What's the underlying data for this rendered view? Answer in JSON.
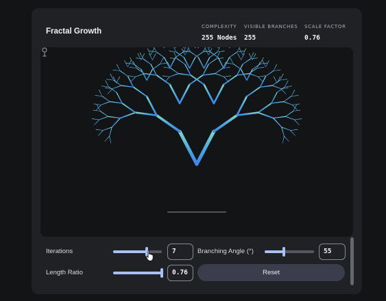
{
  "app": {
    "title": "Fractal Growth"
  },
  "stats": [
    {
      "label": "COMPLEXITY",
      "value": "255 Nodes"
    },
    {
      "label": "VISIBLE BRANCHES",
      "value": "255"
    },
    {
      "label": "SCALE FACTOR",
      "value": "0.76"
    }
  ],
  "fractal": {
    "iterations": 7,
    "branching_angle_deg": 55,
    "length_ratio": 0.76,
    "trunk_color": "#3f86e8",
    "tip_color": "#7fd6c8"
  },
  "controls": {
    "iterations": {
      "label": "Iterations",
      "value": "7",
      "fraction": 0.69
    },
    "angle": {
      "label": "Branching Angle (°)",
      "value": "55",
      "fraction": 0.39
    },
    "length": {
      "label": "Length Ratio",
      "value": "0.76",
      "fraction": 0.98
    },
    "reset_label": "Reset"
  },
  "icons": {
    "seed": "sprout-icon",
    "cursor": "pointer-hand-icon"
  }
}
